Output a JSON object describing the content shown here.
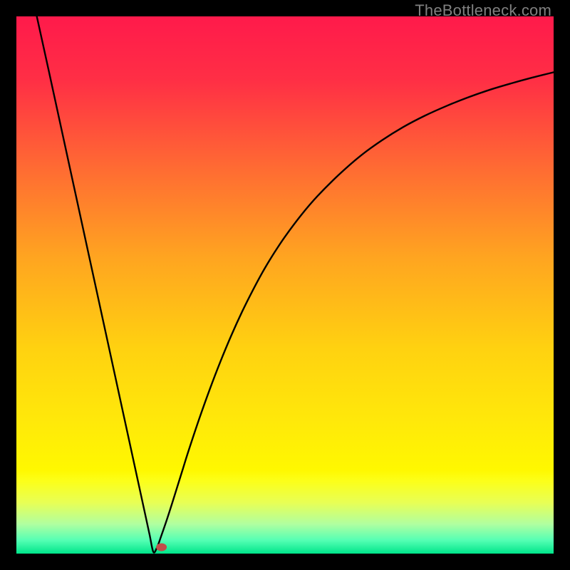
{
  "watermark": "TheBottleneck.com",
  "chart_data": {
    "type": "line",
    "title": "",
    "xlabel": "",
    "ylabel": "",
    "xlim": [
      0,
      100
    ],
    "ylim": [
      0,
      100
    ],
    "x_opt": 25.5,
    "gradient_stops": [
      {
        "offset": 0.0,
        "color": "#ff1a4b"
      },
      {
        "offset": 0.12,
        "color": "#ff2f45"
      },
      {
        "offset": 0.28,
        "color": "#ff6a33"
      },
      {
        "offset": 0.45,
        "color": "#ffa520"
      },
      {
        "offset": 0.62,
        "color": "#ffd210"
      },
      {
        "offset": 0.75,
        "color": "#ffe80a"
      },
      {
        "offset": 0.845,
        "color": "#fff800"
      },
      {
        "offset": 0.865,
        "color": "#fcff1a"
      },
      {
        "offset": 0.905,
        "color": "#e8ff55"
      },
      {
        "offset": 0.945,
        "color": "#b0ffa0"
      },
      {
        "offset": 0.975,
        "color": "#55ffb4"
      },
      {
        "offset": 1.0,
        "color": "#00e58a"
      }
    ],
    "marker": {
      "x": 27,
      "y": 1.2,
      "color": "#c14e4a"
    },
    "series": [
      {
        "name": "curve",
        "x": [
          3.8,
          6,
          8,
          10,
          12,
          14,
          16,
          18,
          20,
          22,
          24,
          24.8,
          25.5,
          26.2,
          27,
          28,
          29,
          30,
          31,
          32,
          34,
          36,
          38,
          40,
          42,
          44,
          46,
          48,
          50,
          53,
          56,
          60,
          64,
          68,
          72,
          76,
          80,
          84,
          88,
          92,
          96,
          100
        ],
        "y": [
          100,
          90,
          80.8,
          71.6,
          62.4,
          53.2,
          44,
          34.8,
          25.6,
          16.4,
          7.2,
          3.5,
          0.3,
          1.2,
          3.4,
          6.3,
          9.4,
          12.6,
          15.8,
          19,
          25,
          30.6,
          35.8,
          40.6,
          45,
          49,
          52.7,
          56,
          59,
          63,
          66.5,
          70.5,
          74,
          76.9,
          79.4,
          81.5,
          83.3,
          84.9,
          86.3,
          87.5,
          88.6,
          89.6
        ]
      }
    ]
  }
}
